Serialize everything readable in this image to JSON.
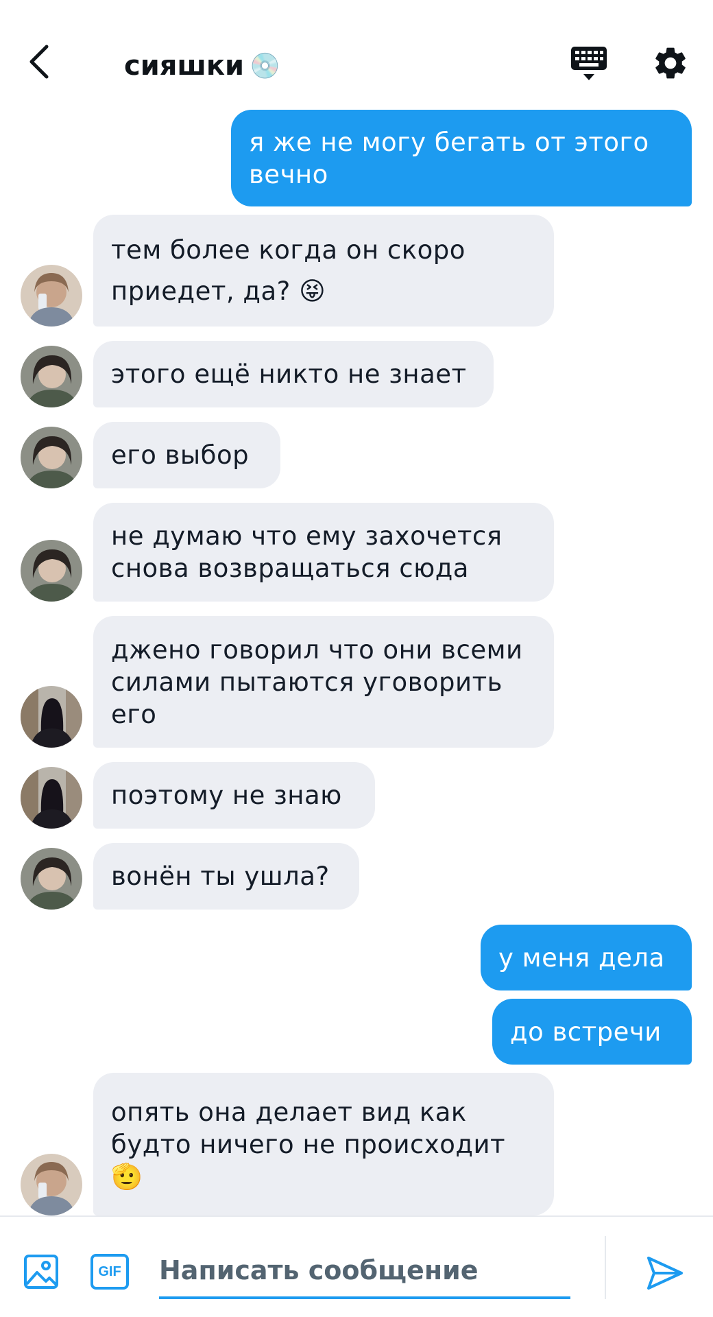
{
  "header": {
    "title": "сияшки",
    "title_emoji": "💿",
    "back_icon": "chevron-left-icon",
    "keyboard_icon": "keyboard-icon",
    "settings_icon": "gear-icon"
  },
  "messages": [
    {
      "side": "out",
      "text": "я же не могу бегать от этого\nвечно"
    },
    {
      "side": "in",
      "text": "тем более когда он скоро\nприедет, да? 😝"
    },
    {
      "side": "in",
      "text": "этого ещё никто не знает"
    },
    {
      "side": "in",
      "text": "его выбор"
    },
    {
      "side": "in",
      "text": "не думаю что ему захочется\nснова возвращаться сюда"
    },
    {
      "side": "in",
      "text": "джено говорил что они всеми\nсилами пытаются уговорить\nего"
    },
    {
      "side": "in",
      "text": "поэтому не знаю"
    },
    {
      "side": "in",
      "text": "вонён ты ушла?"
    },
    {
      "side": "out",
      "text": "у меня дела"
    },
    {
      "side": "out",
      "text": "до встречи"
    },
    {
      "side": "in",
      "text": "опять она делает вид как\nбудто ничего не происходит\n🫡"
    }
  ],
  "composer": {
    "placeholder": "Написать сообщение",
    "gif_label": "GIF",
    "image_icon": "image-icon",
    "send_icon": "send-icon"
  },
  "colors": {
    "accent": "#1d9bf0",
    "incoming_bubble": "#eceef3",
    "text": "#141c28"
  }
}
